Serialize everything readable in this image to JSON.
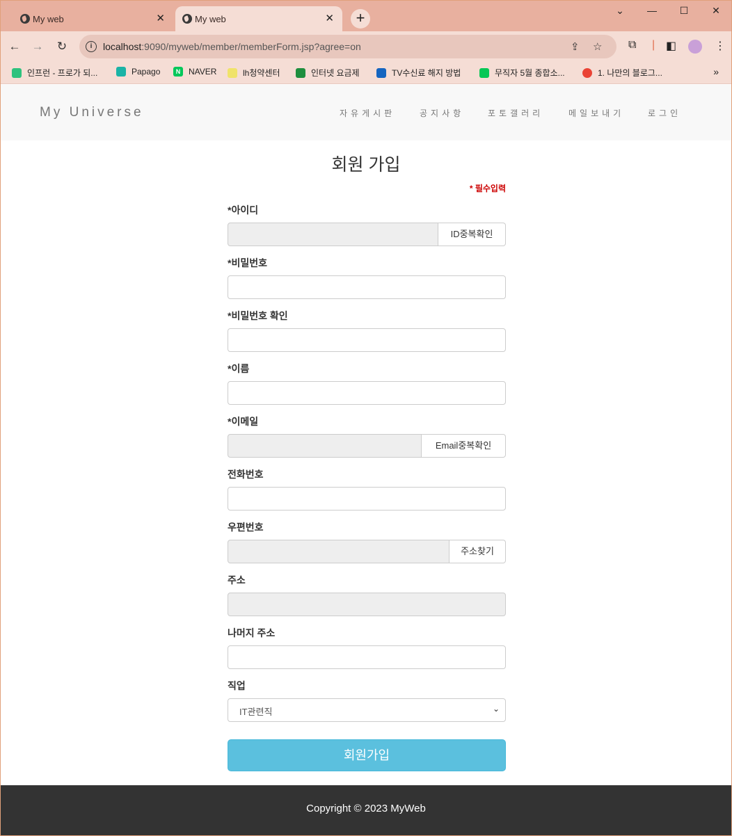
{
  "browser": {
    "tabs": [
      {
        "title": "My web"
      },
      {
        "title": "My web"
      }
    ],
    "url_host": "localhost",
    "url_rest": ":9090/myweb/member/memberForm.jsp?agree=on",
    "bookmarks": [
      {
        "label": "인프런 - 프로가 되...",
        "icon": "inflearn-icon",
        "color": "#2ec27e"
      },
      {
        "label": "Papago",
        "icon": "papago-icon",
        "color": "#1ab3a6"
      },
      {
        "label": "NAVER",
        "icon": "naver-icon",
        "color": "#03c75a"
      },
      {
        "label": "lh청약센터",
        "icon": "lh-icon",
        "color": "#f0e36a"
      },
      {
        "label": "인터넷 요금제",
        "icon": "graduation-icon",
        "color": "#1e8e3e"
      },
      {
        "label": "TV수신료 해지 방법",
        "icon": "kbs-icon",
        "color": "#1565c0"
      },
      {
        "label": "무직자 5월 종합소...",
        "icon": "line-icon",
        "color": "#06c755"
      },
      {
        "label": "1. 나만의 블로그...",
        "icon": "tistory-icon",
        "color": "#ea4335"
      }
    ],
    "more": "»"
  },
  "site": {
    "brand": "My Universe",
    "menu": [
      "자유게시판",
      "공지사항",
      "포토갤러리",
      "메일보내기",
      "로그인"
    ]
  },
  "form": {
    "title": "회원 가입",
    "required_note": "* 필수입력",
    "labels": {
      "id": "*아이디",
      "password": "*비밀번호",
      "password_confirm": "*비밀번호 확인",
      "name": "*이름",
      "email": "*이메일",
      "phone": "전화번호",
      "zipcode": "우편번호",
      "address": "주소",
      "address_detail": "나머지 주소",
      "job": "직업"
    },
    "buttons": {
      "id_check": "ID중복확인",
      "email_check": "Email중복확인",
      "find_address": "주소찾기",
      "submit": "회원가입"
    },
    "job_selected": "IT관련직"
  },
  "footer": {
    "copyright": "Copyright © 2023 MyWeb"
  }
}
